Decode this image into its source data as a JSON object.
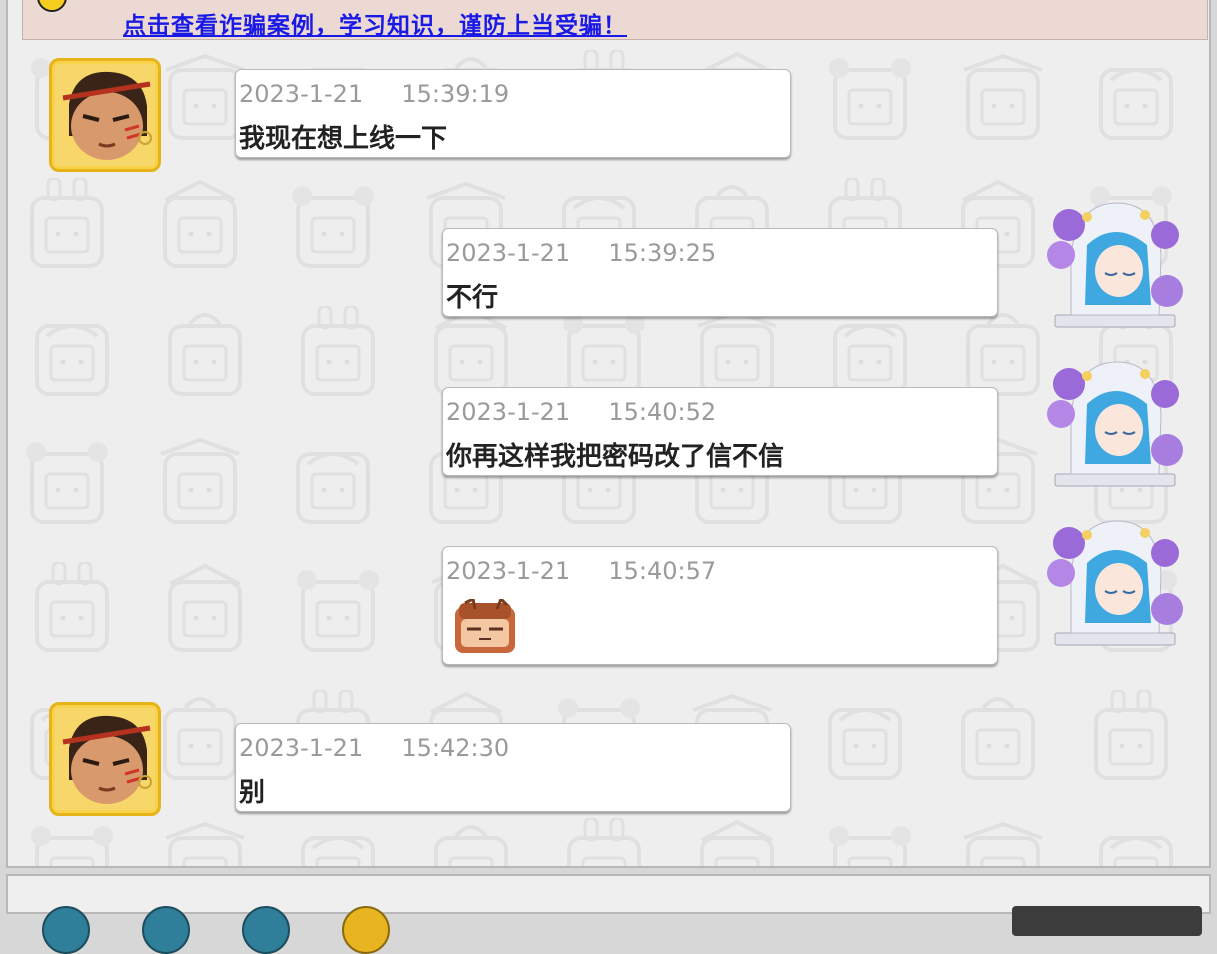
{
  "notice": {
    "link_text": "点击查看诈骗案例，学习知识，谨防上当受骗！",
    "icon": "warning-icon"
  },
  "colors": {
    "notice_link": "#1a1ae6",
    "notice_bg": "#ecd9d4",
    "bubble_bg": "#ffffff",
    "timestamp": "#9a9a9a",
    "avatar_frame": "#e6b418"
  },
  "messages": [
    {
      "sender": "friend",
      "date": "2023-1-21",
      "time": "15:39:19",
      "text": "我现在想上线一下"
    },
    {
      "sender": "self",
      "date": "2023-1-21",
      "time": "15:39:25",
      "text": "不行"
    },
    {
      "sender": "self",
      "date": "2023-1-21",
      "time": "15:40:52",
      "text": "你再这样我把密码改了信不信"
    },
    {
      "sender": "self",
      "date": "2023-1-21",
      "time": "15:40:57",
      "sticker": "sleepy-block-emoji"
    },
    {
      "sender": "friend",
      "date": "2023-1-21",
      "time": "15:42:30",
      "text": "别"
    }
  ]
}
